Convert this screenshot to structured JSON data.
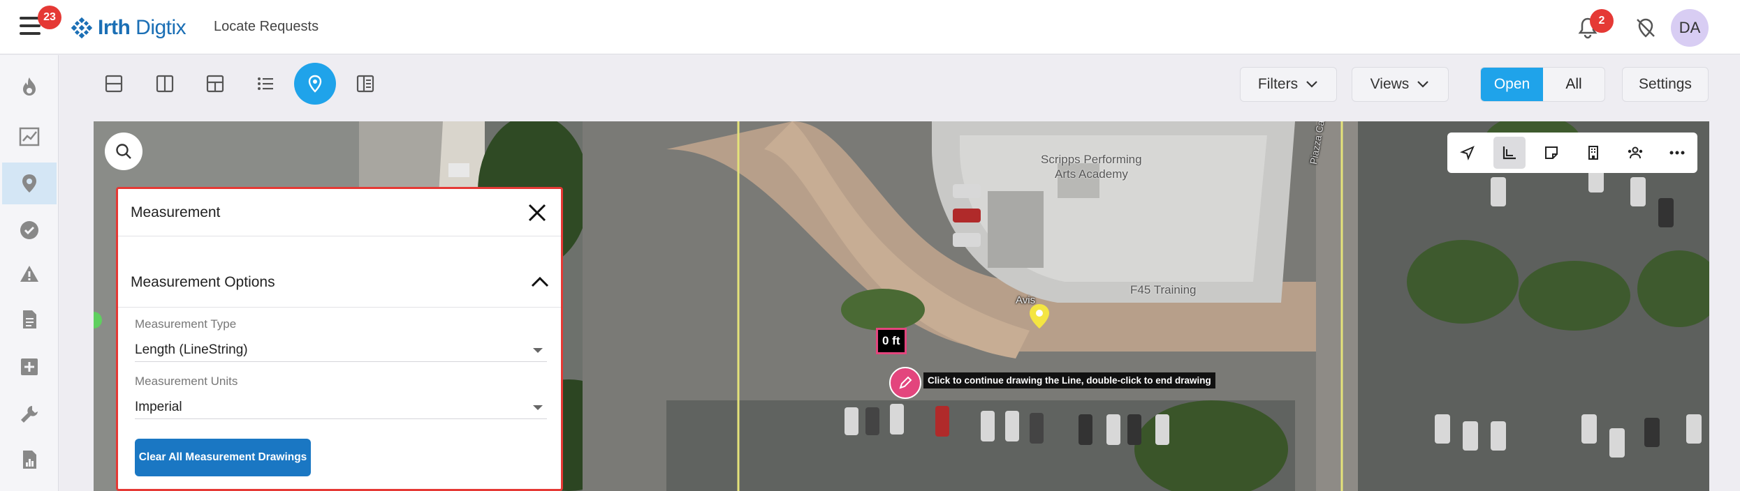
{
  "header": {
    "menu_badge": "23",
    "logo_text_bold": "Irth",
    "logo_text_rest": "Digtix",
    "page_name": "Locate Requests",
    "notification_badge": "2",
    "avatar_initials": "DA"
  },
  "toolbar": {
    "filters_label": "Filters",
    "views_label": "Views",
    "open_label": "Open",
    "all_label": "All",
    "settings_label": "Settings",
    "active_view": "map"
  },
  "map": {
    "labels": {
      "school": "Scripps Performing",
      "school2": "Arts Academy",
      "training": "F45 Training",
      "avis": "Avis",
      "street": "Piazza Carmel Drive"
    },
    "measure_value": "0 ft",
    "draw_hint": "Click to continue drawing the Line, double-click to end drawing",
    "active_tool": "measure"
  },
  "panel": {
    "title": "Measurement",
    "options_title": "Measurement Options",
    "type_label": "Measurement Type",
    "type_value": "Length (LineString)",
    "units_label": "Measurement Units",
    "units_value": "Imperial",
    "clear_button": "Clear All Measurement Drawings"
  },
  "colors": {
    "accent": "#1fa3ea",
    "brand": "#1b6fb5",
    "badge": "#e53935",
    "measure": "#e3457d",
    "primary_button": "#1a77c3"
  }
}
